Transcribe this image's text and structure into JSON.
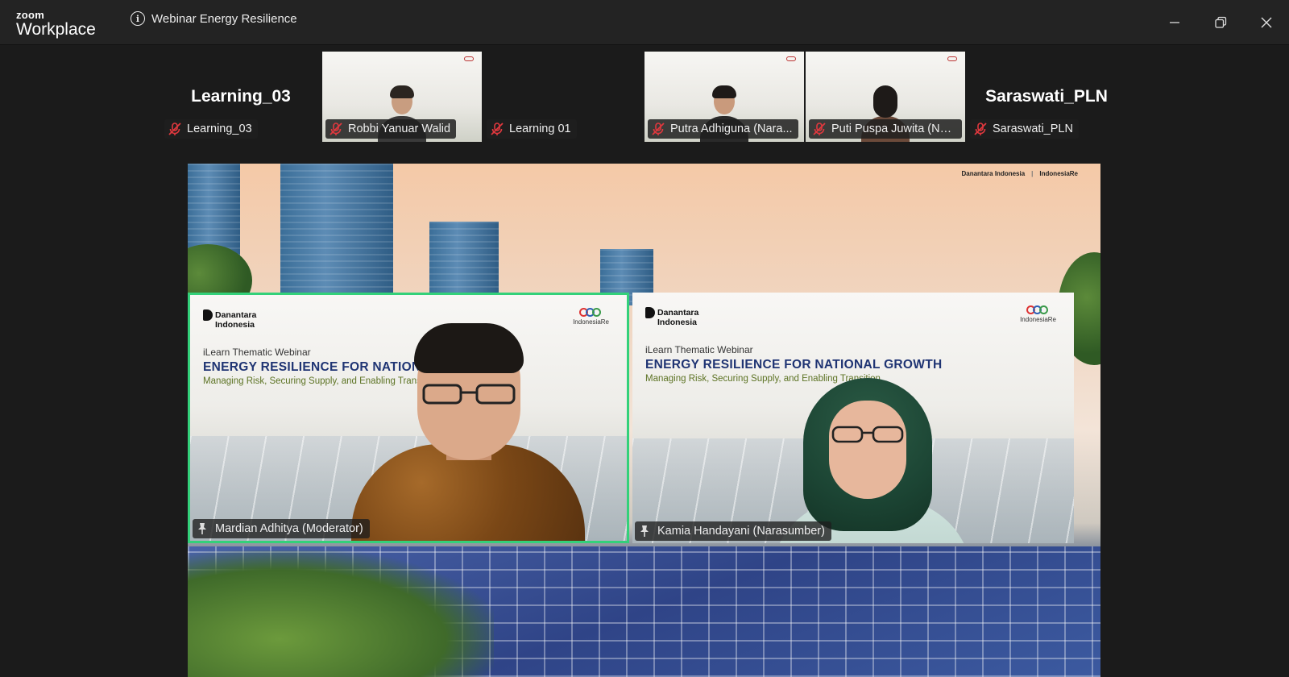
{
  "window": {
    "app_brand_top": "zoom",
    "app_brand_bottom": "Workplace",
    "meeting_title": "Webinar Energy Resilience"
  },
  "strip": {
    "tiles": [
      {
        "big_name": "Learning_03",
        "label": "Learning_03",
        "video": false
      },
      {
        "big_name": "",
        "label": "Robbi Yanuar Walid",
        "video": true
      },
      {
        "big_name": "",
        "label": "Learning 01",
        "video": false
      },
      {
        "big_name": "",
        "label": "Putra Adhiguna (Nara...",
        "video": true
      },
      {
        "big_name": "",
        "label": "Puti Puspa Juwita (Nar...",
        "video": true
      },
      {
        "big_name": "Saraswati_PLN",
        "label": "Saraswati_PLN",
        "video": false
      }
    ]
  },
  "stage": {
    "logo_left": "Danantara Indonesia",
    "logo_right": "IndonesiaRe"
  },
  "speakers": [
    {
      "logo_left_line1": "Danantara",
      "logo_left_line2": "Indonesia",
      "logo_right": "IndonesiaRe",
      "kicker": "iLearn Thematic Webinar",
      "title": "ENERGY RESILIENCE FOR NATIONAL GROWTH",
      "subtitle": "Managing Risk, Securing Supply, and Enabling Transition",
      "name": "Mardian Adhitya (Moderator)",
      "active": true
    },
    {
      "logo_left_line1": "Danantara",
      "logo_left_line2": "Indonesia",
      "logo_right": "IndonesiaRe",
      "kicker": "iLearn Thematic Webinar",
      "title": "ENERGY RESILIENCE FOR NATIONAL GROWTH",
      "subtitle": "Managing Risk, Securing Supply, and Enabling Transition",
      "name": "Kamia Handayani (Narasumber)",
      "active": false
    }
  ],
  "icons": {
    "muted": "mic-off-icon",
    "spotlight": "pin-icon",
    "info": "info-icon",
    "minimize": "minimize-icon",
    "restore": "restore-icon",
    "close": "close-icon"
  },
  "colors": {
    "active_speaker_border": "#33d17a",
    "mute_red": "#e0383e",
    "titlebar": "#232323"
  }
}
